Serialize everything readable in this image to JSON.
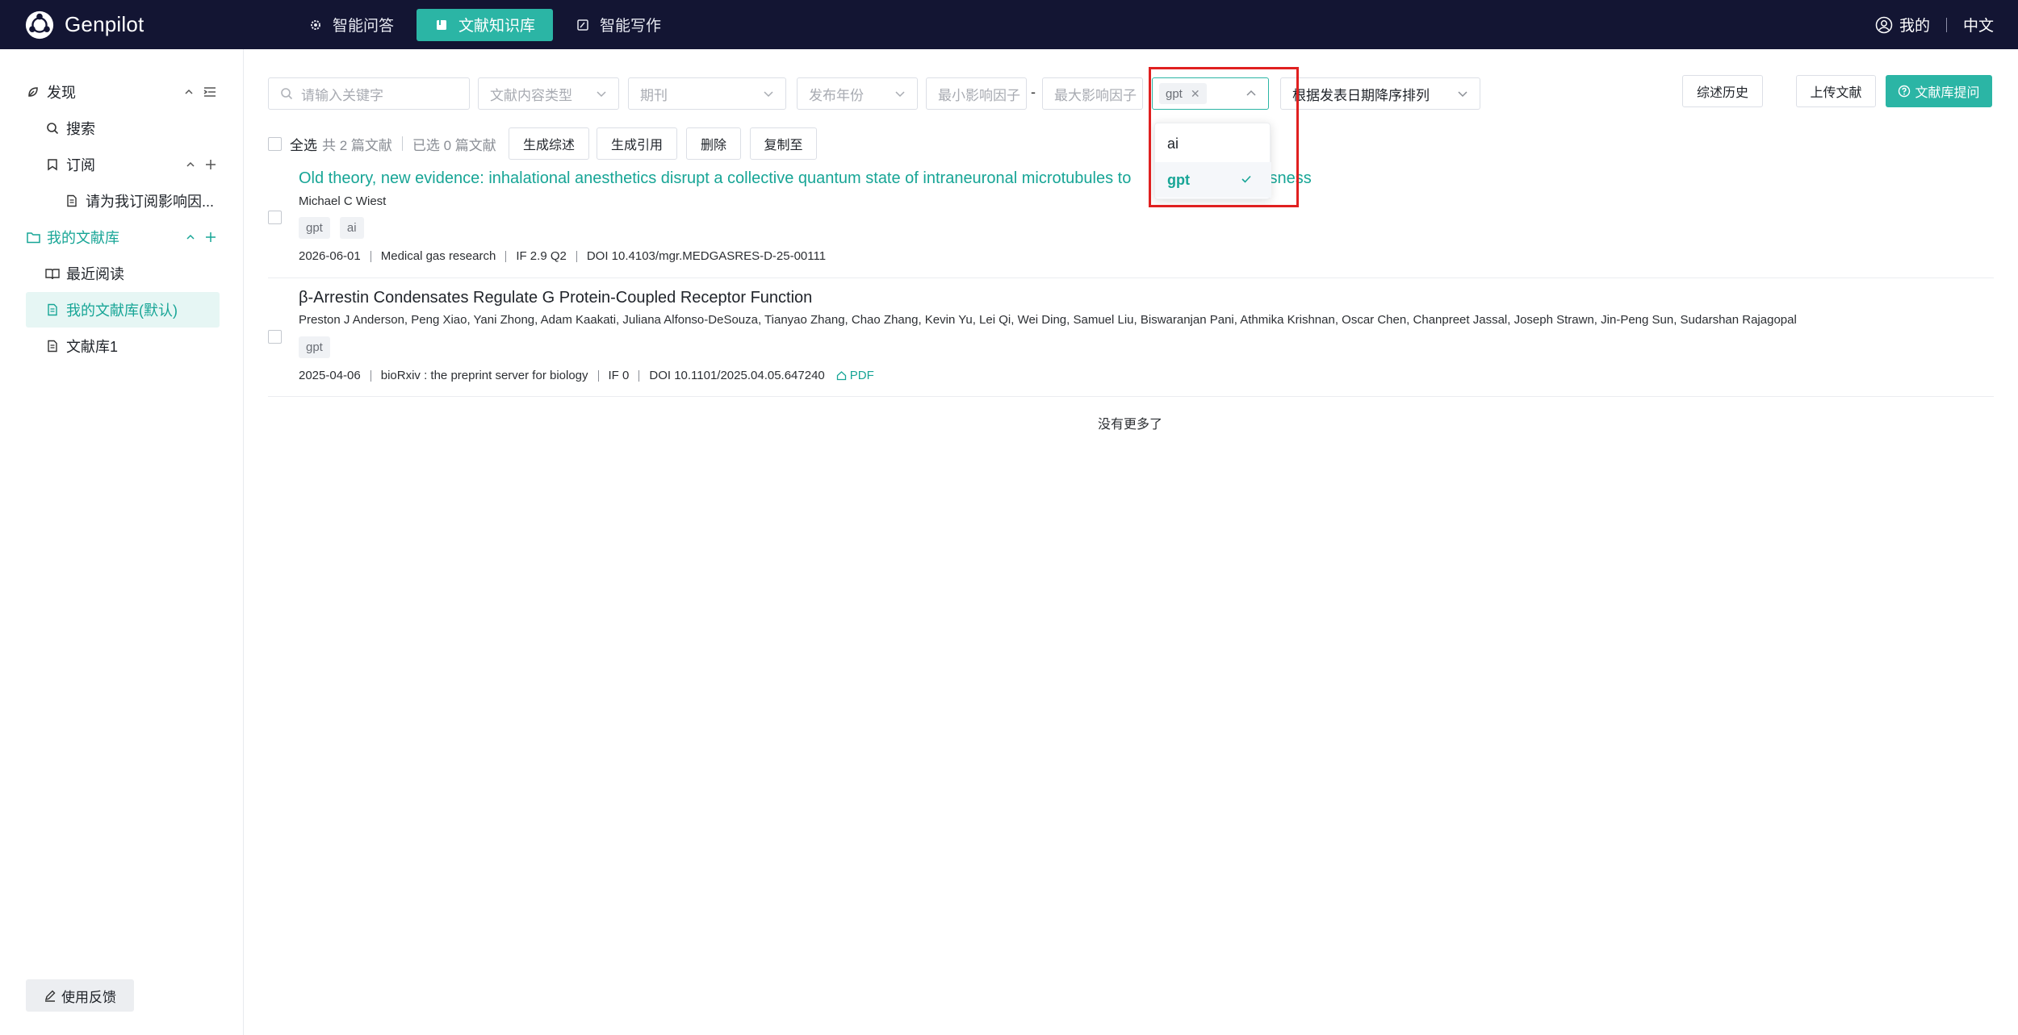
{
  "app": {
    "name": "Genpilot"
  },
  "nav": {
    "tabs": [
      {
        "label": "智能问答",
        "icon": "gear-icon"
      },
      {
        "label": "文献知识库",
        "icon": "book-icon",
        "active": true
      },
      {
        "label": "智能写作",
        "icon": "edit-icon"
      }
    ],
    "user_label": "我的",
    "language": "中文"
  },
  "sidebar": {
    "discover": "发现",
    "search": "搜索",
    "subscribe": "订阅",
    "subscription_item": "请为我订阅影响因...",
    "my_library": "我的文献库",
    "recent": "最近阅读",
    "default_library": "我的文献库(默认)",
    "library1": "文献库1",
    "feedback": "使用反馈"
  },
  "filters": {
    "keyword_placeholder": "请输入关键字",
    "content_type": "文献内容类型",
    "journal": "期刊",
    "year": "发布年份",
    "min_if": "最小影响因子",
    "dash": "-",
    "max_if": "最大影响因子",
    "tag_selected": "gpt",
    "sort": "根据发表日期降序排列"
  },
  "actions": {
    "history": "综述历史",
    "upload": "上传文献",
    "ask": "文献库提问"
  },
  "toolbar": {
    "select_all": "全选",
    "total": "共 2 篇文献",
    "selected": "已选 0 篇文献",
    "gen_review": "生成综述",
    "gen_cite": "生成引用",
    "delete": "删除",
    "copy_to": "复制至"
  },
  "items": [
    {
      "title": "Old theory, new evidence: inhalational anesthetics disrupt a collective quantum state of intraneuronal microtubules to",
      "title_tail": "usness",
      "authors": "Michael C Wiest",
      "tags": [
        "gpt",
        "ai"
      ],
      "date": "2026-06-01",
      "journal": "Medical gas research",
      "if": "IF 2.9 Q2",
      "doi": "DOI 10.4103/mgr.MEDGASRES-D-25-00111"
    },
    {
      "title": "β-Arrestin Condensates Regulate G Protein-Coupled Receptor Function",
      "authors": "Preston J Anderson, Peng Xiao, Yani Zhong, Adam Kaakati, Juliana Alfonso-DeSouza, Tianyao Zhang, Chao Zhang, Kevin Yu, Lei Qi, Wei Ding, Samuel Liu, Biswaranjan Pani, Athmika Krishnan, Oscar Chen, Chanpreet Jassal, Joseph Strawn, Jin-Peng Sun, Sudarshan Rajagopal",
      "tags": [
        "gpt"
      ],
      "date": "2025-04-06",
      "journal": "bioRxiv : the preprint server for biology",
      "if": "IF 0",
      "doi": "DOI 10.1101/2025.04.05.647240",
      "pdf": "PDF"
    }
  ],
  "no_more": "没有更多了",
  "dropdown": {
    "options": [
      "ai",
      "gpt"
    ],
    "selected": "gpt"
  },
  "colors": {
    "accent": "#2bb5a5",
    "topbar": "#131533",
    "highlight_box": "#e02020"
  }
}
